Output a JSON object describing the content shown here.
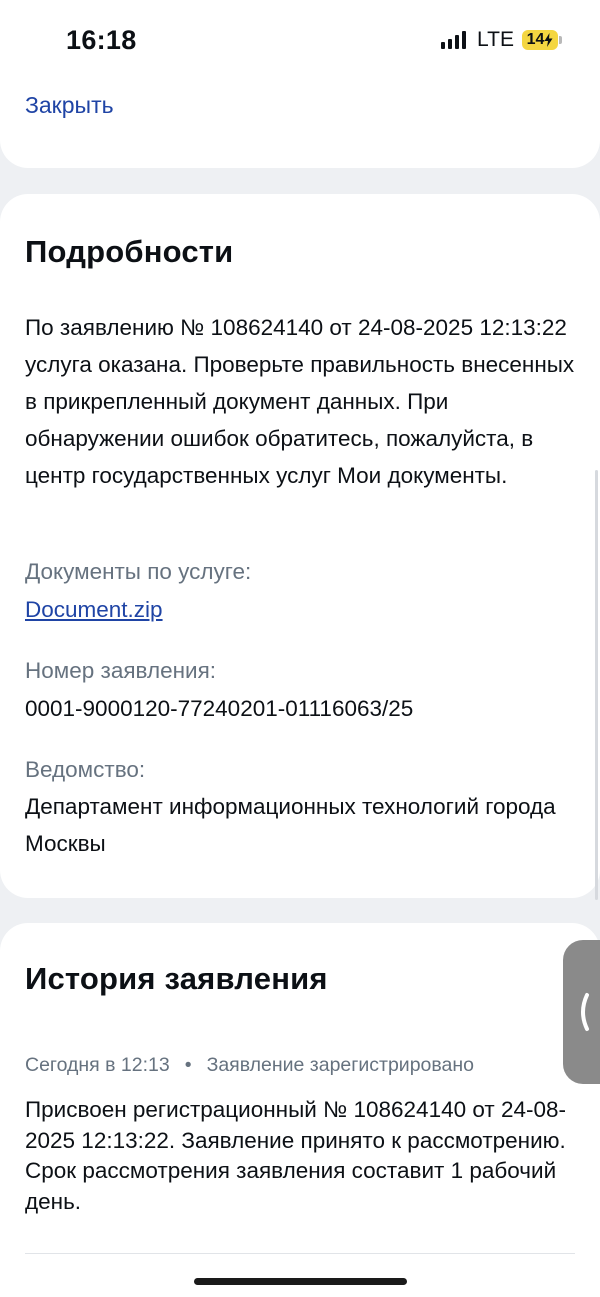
{
  "status_bar": {
    "time": "16:18",
    "network": "LTE",
    "battery": "14"
  },
  "top": {
    "close_label": "Закрыть"
  },
  "details": {
    "title": "Подробности",
    "text": "По заявлению № 108624140 от 24-08-2025 12:13:22 услуга оказана. Проверьте правильность внесенных в прикрепленный документ данных. При обнаружении ошибок обратитесь, пожалуйста, в центр государственных услуг Мои документы.",
    "documents_label": "Документы по услуге:",
    "document_file": "Document.zip",
    "application_number_label": "Номер заявления:",
    "application_number": "0001-9000120-77240201-01116063/25",
    "agency_label": "Ведомство:",
    "agency": "Департамент информационных технологий города Москвы"
  },
  "history": {
    "title": "История заявления",
    "entries": [
      {
        "time": "Сегодня в 12:13",
        "separator": "•",
        "status": "Заявление зарегистрировано",
        "text": "Присвоен регистрационный № 108624140 от 24-08-2025 12:13:22. Заявление принято к рассмотрению. Срок рассмотрения заявления составит 1 рабочий день."
      }
    ]
  },
  "icons": {
    "signal": "signal-bars-icon",
    "battery": "battery-charging-icon",
    "side_handle": "chevron-left-icon"
  },
  "colors": {
    "link": "#1f44a5",
    "muted": "#66727f",
    "background": "#eef0f3",
    "battery": "#f4d641"
  }
}
